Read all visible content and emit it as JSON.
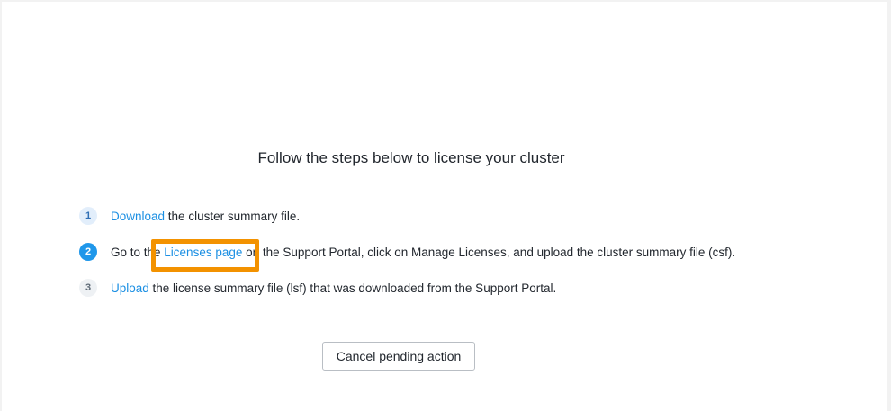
{
  "heading": "Follow the steps below to license your cluster",
  "steps": [
    {
      "number": "1",
      "link": "Download",
      "after": " the cluster summary file."
    },
    {
      "number": "2",
      "before": "Go to the ",
      "link": "Licenses page",
      "after": " on the Support Portal, click on Manage Licenses, and upload the cluster summary file (csf)."
    },
    {
      "number": "3",
      "link": "Upload",
      "after": " the license summary file (lsf) that was downloaded from the Support Portal."
    }
  ],
  "cancel_button": "Cancel pending action",
  "colors": {
    "link": "#1b8fe3",
    "active_step": "#1f97ea",
    "highlight": "#f39200",
    "text": "#22272e"
  }
}
